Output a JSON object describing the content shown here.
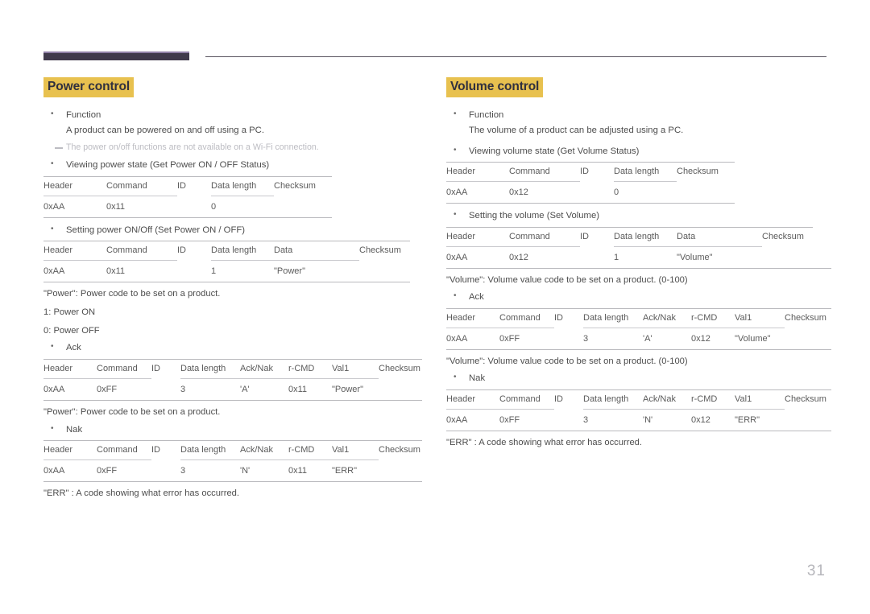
{
  "page": {
    "number": "31"
  },
  "left": {
    "title": "Power control",
    "function_label": "Function",
    "function_desc": "A product can be powered on and off using a PC.",
    "note": "The power on/off functions are not available on a Wi-Fi connection.",
    "get_status_label": "Viewing power state (Get Power ON / OFF Status)",
    "get_status_table": {
      "headers": [
        "Header",
        "Command",
        "ID",
        "Data length",
        "Checksum"
      ],
      "values": [
        "0xAA",
        "0x11",
        "",
        "0",
        ""
      ]
    },
    "set_label": "Setting power ON/Off (Set Power ON / OFF)",
    "set_table": {
      "headers": [
        "Header",
        "Command",
        "ID",
        "Data length",
        "Data",
        "Checksum"
      ],
      "values": [
        "0xAA",
        "0x11",
        "",
        "1",
        "\"Power\"",
        ""
      ]
    },
    "power_caption": "\"Power\": Power code to be set on a product.",
    "power_on": "1: Power ON",
    "power_off": "0: Power OFF",
    "ack_label": "Ack",
    "ack_table": {
      "headers": [
        "Header",
        "Command",
        "ID",
        "Data length",
        "Ack/Nak",
        "r-CMD",
        "Val1",
        "Checksum"
      ],
      "values": [
        "0xAA",
        "0xFF",
        "",
        "3",
        "'A'",
        "0x11",
        "\"Power\"",
        ""
      ]
    },
    "ack_caption": "\"Power\": Power code to be set on a product.",
    "nak_label": "Nak",
    "nak_table": {
      "headers": [
        "Header",
        "Command",
        "ID",
        "Data length",
        "Ack/Nak",
        "r-CMD",
        "Val1",
        "Checksum"
      ],
      "values": [
        "0xAA",
        "0xFF",
        "",
        "3",
        "'N'",
        "0x11",
        "\"ERR\"",
        ""
      ]
    },
    "err_caption": "\"ERR\" : A code showing what error has occurred."
  },
  "right": {
    "title": "Volume control",
    "function_label": "Function",
    "function_desc": "The volume of a product can be adjusted using a PC.",
    "get_status_label": "Viewing volume state (Get Volume Status)",
    "get_status_table": {
      "headers": [
        "Header",
        "Command",
        "ID",
        "Data length",
        "Checksum"
      ],
      "values": [
        "0xAA",
        "0x12",
        "",
        "0",
        ""
      ]
    },
    "set_label": "Setting the volume (Set Volume)",
    "set_table": {
      "headers": [
        "Header",
        "Command",
        "ID",
        "Data length",
        "Data",
        "Checksum"
      ],
      "values": [
        "0xAA",
        "0x12",
        "",
        "1",
        "\"Volume\"",
        ""
      ]
    },
    "volume_caption": "\"Volume\": Volume value code to be set on a product. (0-100)",
    "ack_label": "Ack",
    "ack_table": {
      "headers": [
        "Header",
        "Command",
        "ID",
        "Data length",
        "Ack/Nak",
        "r-CMD",
        "Val1",
        "Checksum"
      ],
      "values": [
        "0xAA",
        "0xFF",
        "",
        "3",
        "'A'",
        "0x12",
        "\"Volume\"",
        ""
      ]
    },
    "ack_caption": "\"Volume\": Volume value code to be set on a product. (0-100)",
    "nak_label": "Nak",
    "nak_table": {
      "headers": [
        "Header",
        "Command",
        "ID",
        "Data length",
        "Ack/Nak",
        "r-CMD",
        "Val1",
        "Checksum"
      ],
      "values": [
        "0xAA",
        "0xFF",
        "",
        "3",
        "'N'",
        "0x12",
        "\"ERR\"",
        ""
      ]
    },
    "err_caption": "\"ERR\" : A code showing what error has occurred."
  },
  "colors": {
    "highlight": "#e8c14f",
    "heading_text": "#30303e",
    "rule_bar": "#403a4c",
    "rule_bar_top": "#8f7fa6",
    "body_text": "#4d4d4d",
    "table_text": "#5b5b5b",
    "note_text": "#bcbcc2",
    "table_rule": "#b9b9bd",
    "page_number": "#b6b6bb"
  }
}
